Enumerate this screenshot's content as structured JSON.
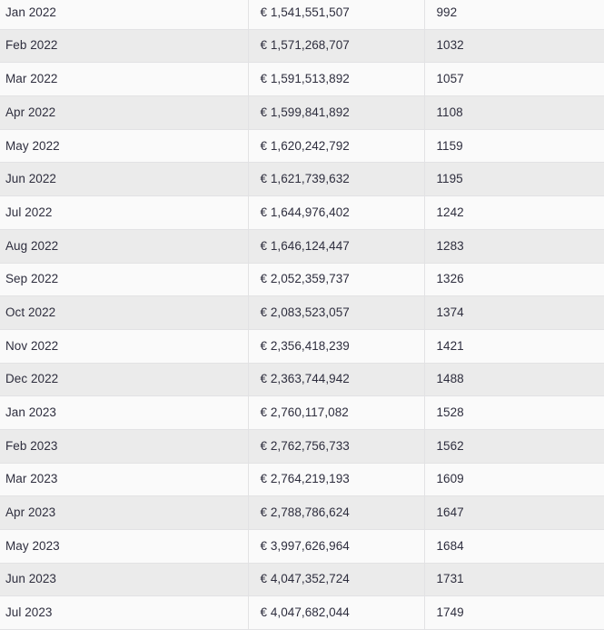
{
  "table": {
    "columns": [
      {
        "key": "period",
        "header": ""
      },
      {
        "key": "amount",
        "header": ""
      },
      {
        "key": "count",
        "header": ""
      }
    ],
    "currency_symbol": "€",
    "rows": [
      {
        "period": "Jan 2022",
        "amount": "€ 1,541,551,507",
        "count": "992"
      },
      {
        "period": "Feb 2022",
        "amount": "€ 1,571,268,707",
        "count": "1032"
      },
      {
        "period": "Mar 2022",
        "amount": "€ 1,591,513,892",
        "count": "1057"
      },
      {
        "period": "Apr 2022",
        "amount": "€ 1,599,841,892",
        "count": "1108"
      },
      {
        "period": "May 2022",
        "amount": "€ 1,620,242,792",
        "count": "1159"
      },
      {
        "period": "Jun 2022",
        "amount": "€ 1,621,739,632",
        "count": "1195"
      },
      {
        "period": "Jul 2022",
        "amount": "€ 1,644,976,402",
        "count": "1242"
      },
      {
        "period": "Aug 2022",
        "amount": "€ 1,646,124,447",
        "count": "1283"
      },
      {
        "period": "Sep 2022",
        "amount": "€ 2,052,359,737",
        "count": "1326"
      },
      {
        "period": "Oct 2022",
        "amount": "€ 2,083,523,057",
        "count": "1374"
      },
      {
        "period": "Nov 2022",
        "amount": "€ 2,356,418,239",
        "count": "1421"
      },
      {
        "period": "Dec 2022",
        "amount": "€ 2,363,744,942",
        "count": "1488"
      },
      {
        "period": "Jan 2023",
        "amount": "€ 2,760,117,082",
        "count": "1528"
      },
      {
        "period": "Feb 2023",
        "amount": "€ 2,762,756,733",
        "count": "1562"
      },
      {
        "period": "Mar 2023",
        "amount": "€ 2,764,219,193",
        "count": "1609"
      },
      {
        "period": "Apr 2023",
        "amount": "€ 2,788,786,624",
        "count": "1647"
      },
      {
        "period": "May 2023",
        "amount": "€ 3,997,626,964",
        "count": "1684"
      },
      {
        "period": "Jun 2023",
        "amount": "€ 4,047,352,724",
        "count": "1731"
      },
      {
        "period": "Jul 2023",
        "amount": "€ 4,047,682,044",
        "count": "1749"
      }
    ]
  },
  "colors": {
    "row_odd_background": "#fafafa",
    "row_even_background": "#ebebeb",
    "border": "#e2e2e4",
    "text": "#2e2e3e",
    "page_background": "#ffffff"
  }
}
